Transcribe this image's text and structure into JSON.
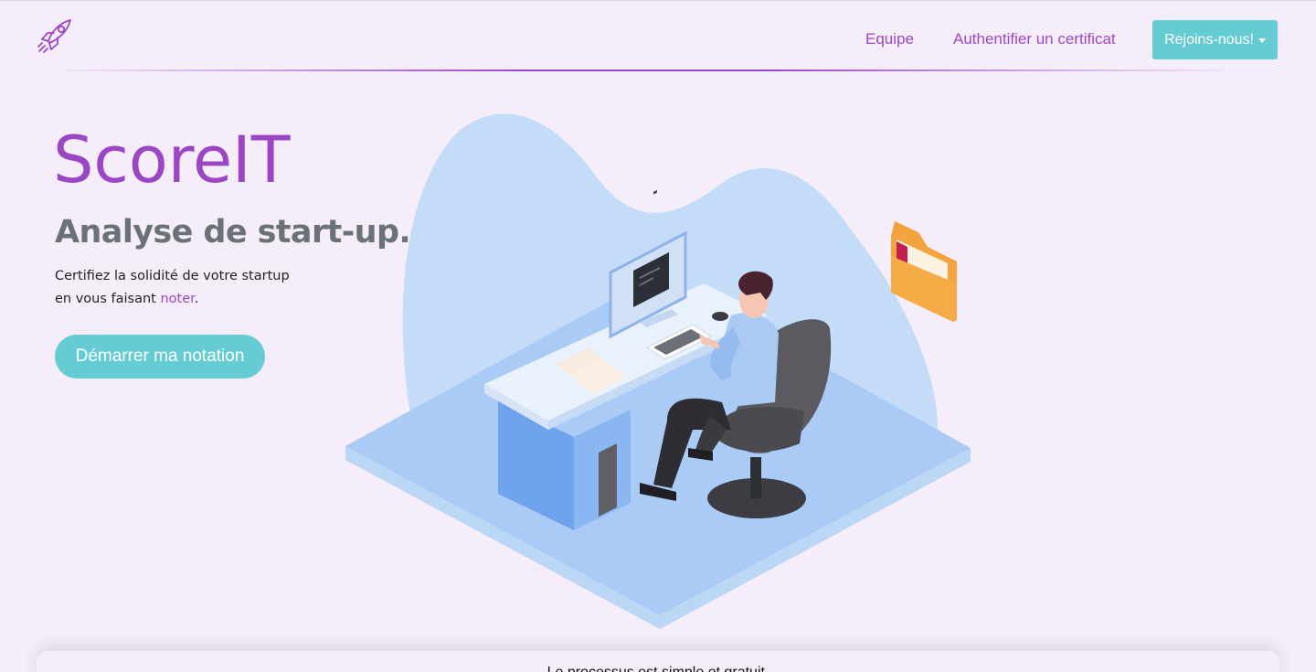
{
  "brand": {
    "logo_icon": "rocket-icon"
  },
  "nav": {
    "equipe": "Equipe",
    "authentifier": "Authentifier un certificat",
    "join": "Rejoins-nous!"
  },
  "hero": {
    "title": "ScoreIT",
    "subtitle": "Analyse de start-up.",
    "desc_line1": "Certifiez la solidité de votre startup",
    "desc_line2_prefix": "en vous faisant ",
    "desc_line2_accent": "noter",
    "desc_line2_suffix": ".",
    "cta": "Démarrer ma notation"
  },
  "illustration": {
    "icon": "person-at-desk-illustration"
  },
  "bottom": {
    "text": "Le processus est simple et gratuit."
  },
  "colors": {
    "accent_purple": "#9b47c5",
    "teal": "#66ccd3",
    "background": "#f5eefa"
  }
}
